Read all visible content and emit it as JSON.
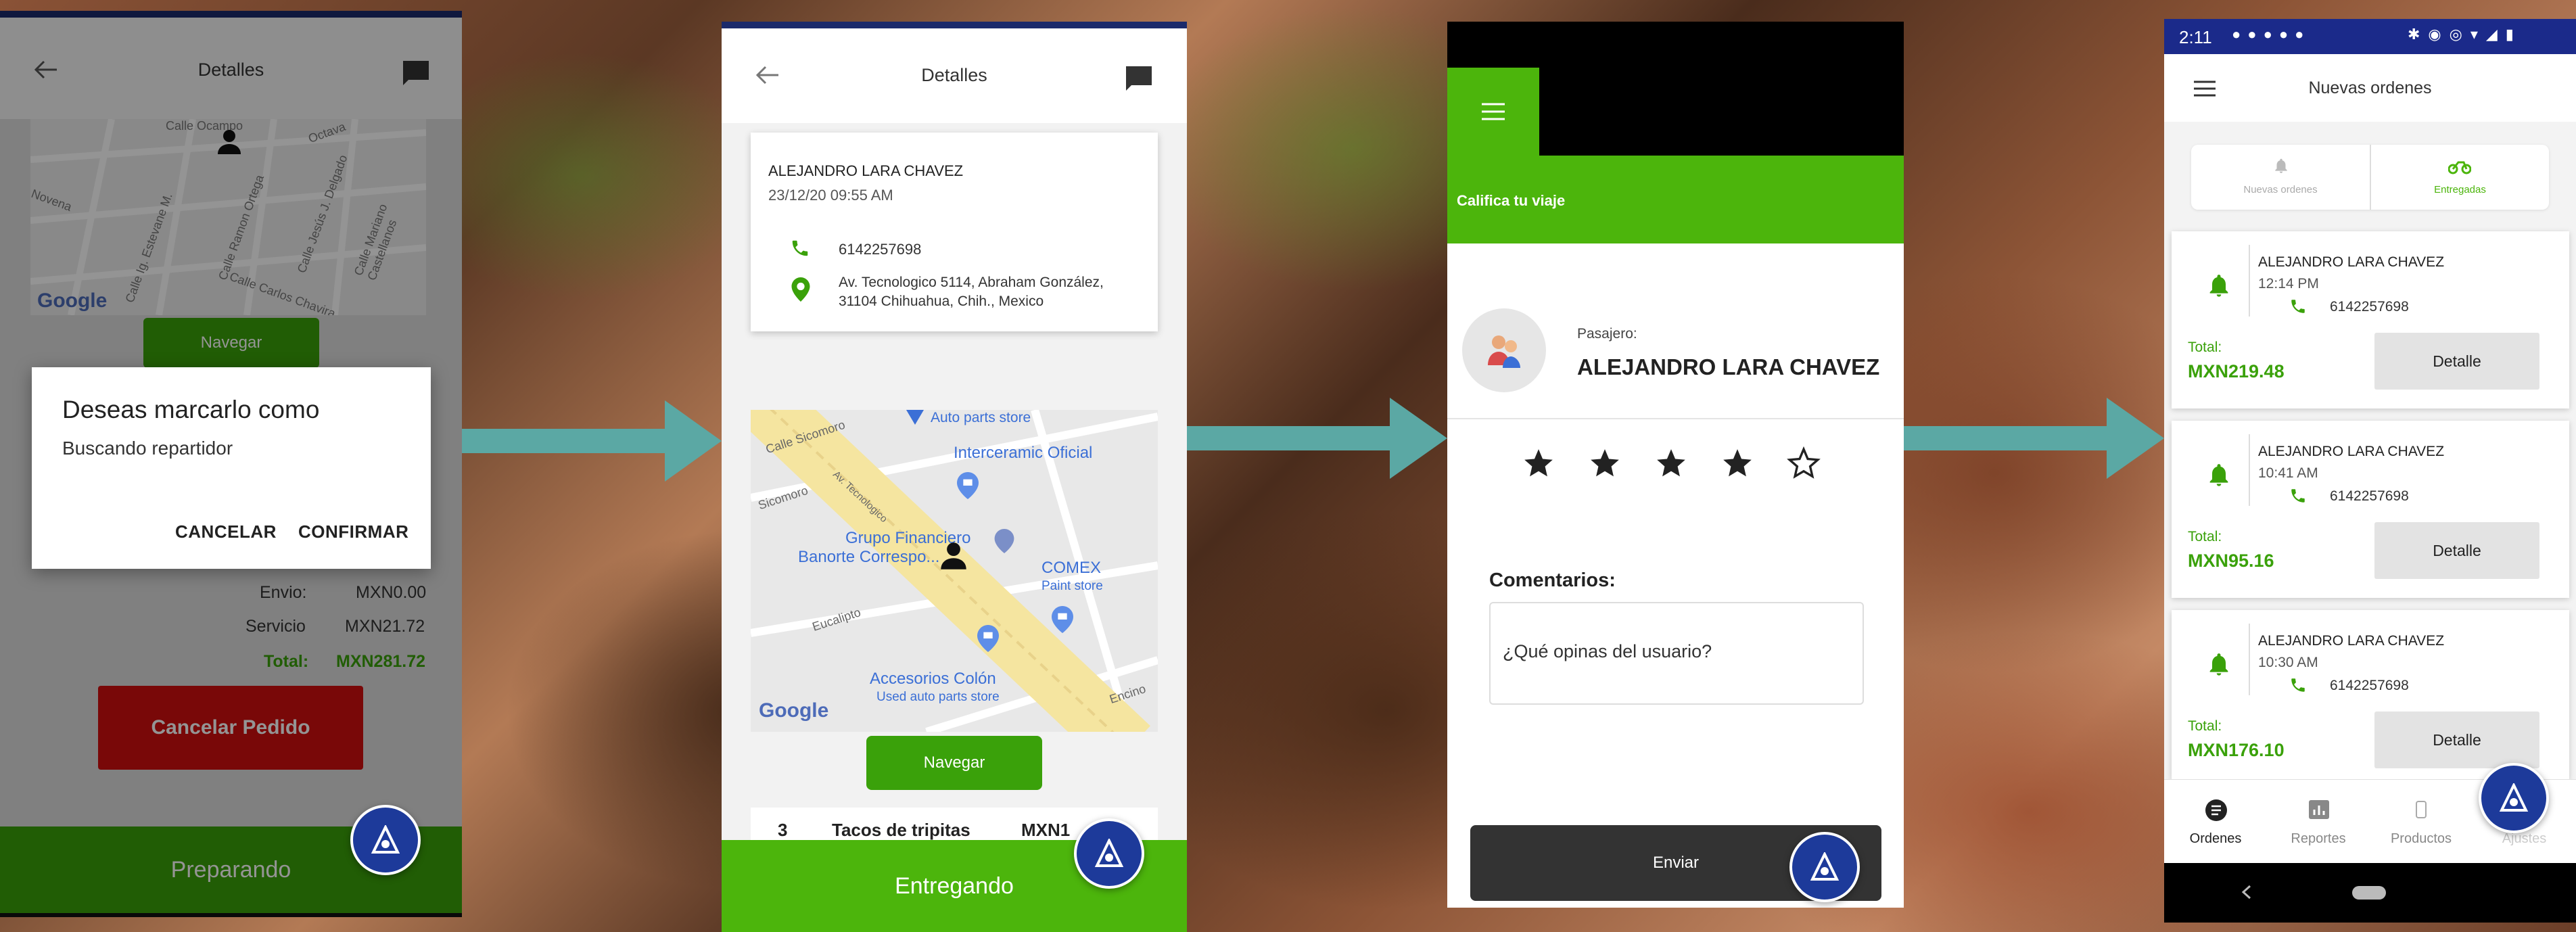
{
  "screen1": {
    "title": "Detalles",
    "navigate_label": "Navegar",
    "dialog": {
      "title": "Deseas marcarlo como",
      "subtitle": "Buscando repartidor",
      "cancel_label": "CANCELAR",
      "confirm_label": "CONFIRMAR"
    },
    "summary": {
      "envio_label": "Envio:",
      "envio_value": "MXN0.00",
      "servicio_label": "Servicio",
      "servicio_value": "MXN21.72",
      "total_label": "Total:",
      "total_value": "MXN281.72"
    },
    "cancel_order_label": "Cancelar Pedido",
    "status_bar_label": "Preparando",
    "map_labels": [
      "Novena",
      "Calle Ramon Ortega",
      "Calle Jesús J. Delgado",
      "Calle Mariano Castellanos",
      "Calle Carlos Chavira",
      "Calle Ocampo",
      "Octava",
      "Calle Ig. Estevane M."
    ],
    "google_label": "Google"
  },
  "screen2": {
    "title": "Detalles",
    "customer_name": "ALEJANDRO LARA CHAVEZ",
    "datetime": "23/12/20 09:55 AM",
    "phone": "6142257698",
    "address_line1": "Av. Tecnologico 5114, Abraham González,",
    "address_line2": "31104 Chihuahua, Chih., Mexico",
    "map_labels": {
      "street1": "Calle Sicomoro",
      "street2": "Sicomoro",
      "street3": "Av. Tecnologico",
      "street4": "Eucalipto",
      "street5": "Encino",
      "poi1": "Auto parts store",
      "poi2": "Interceramic Oficial",
      "poi3": "Grupo Financiero",
      "poi4": "Banorte Correspo...",
      "poi5": "COMEX",
      "poi6": "Paint store",
      "poi7": "Accesorios Colón",
      "poi8": "Used auto parts store"
    },
    "google_label": "Google",
    "navigate_label": "Navegar",
    "row_qty": "3",
    "row_name": "Tacos de tripitas",
    "row_price": "MXN1",
    "status_bar_label": "Entregando"
  },
  "screen3": {
    "section_title": "Califica tu viaje",
    "passenger_label": "Pasajero:",
    "passenger_name": "ALEJANDRO LARA CHAVEZ",
    "rating": {
      "filled": 4,
      "total": 5
    },
    "comments_label": "Comentarios:",
    "comments_placeholder": "¿Qué opinas del usuario?",
    "send_label": "Enviar",
    "accent_color": "#4cb50c"
  },
  "screen4": {
    "status_time": "2:11",
    "title": "Nuevas ordenes",
    "tabs": [
      {
        "label": "Nuevas ordenes"
      },
      {
        "label": "Entregadas"
      }
    ],
    "orders": [
      {
        "name": "ALEJANDRO LARA CHAVEZ",
        "time": "12:14 PM",
        "phone": "6142257698",
        "total_label": "Total:",
        "total": "MXN219.48",
        "button": "Detalle"
      },
      {
        "name": "ALEJANDRO LARA CHAVEZ",
        "time": "10:41 AM",
        "phone": "6142257698",
        "total_label": "Total:",
        "total": "MXN95.16",
        "button": "Detalle"
      },
      {
        "name": "ALEJANDRO LARA CHAVEZ",
        "time": "10:30 AM",
        "phone": "6142257698",
        "total_label": "Total:",
        "total": "MXN176.10",
        "button": "Detalle"
      }
    ],
    "bottom_nav": [
      {
        "label": "Ordenes"
      },
      {
        "label": "Reportes"
      },
      {
        "label": "Productos"
      },
      {
        "label": "Ajustes"
      }
    ],
    "accent_color": "#4cb50c"
  }
}
